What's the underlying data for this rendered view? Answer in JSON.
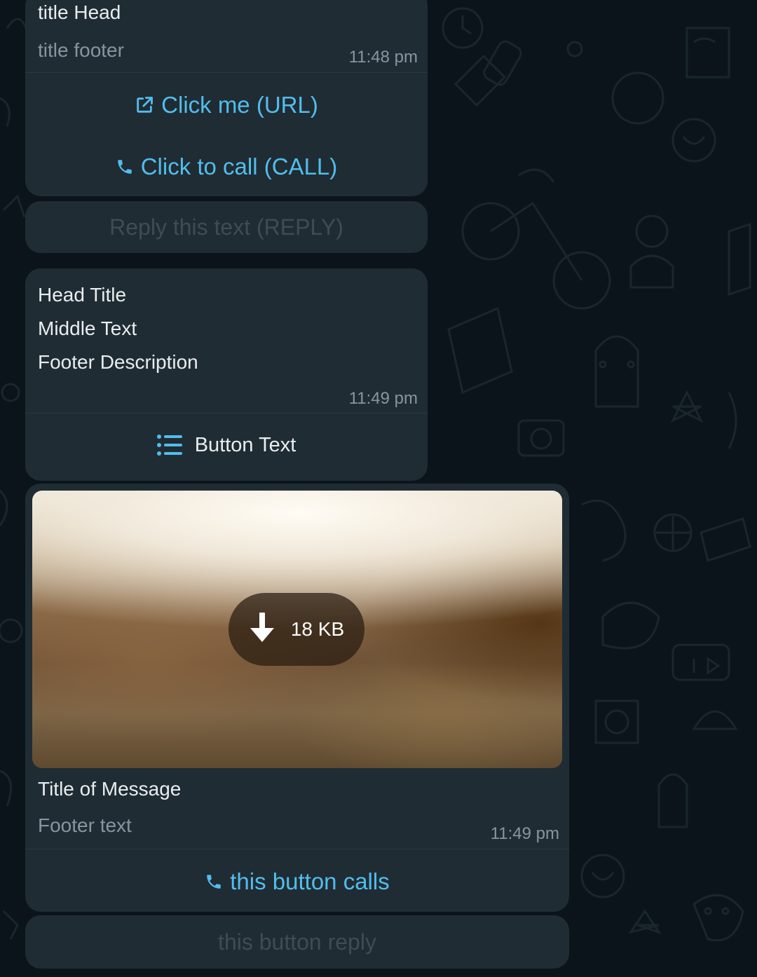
{
  "messages": [
    {
      "header": "title Head",
      "footer": "title footer",
      "time": "11:48 pm",
      "buttons": [
        {
          "label": "Click me (URL)",
          "icon": "external-link-icon"
        },
        {
          "label": "Click to call (CALL)",
          "icon": "phone-icon"
        }
      ],
      "reply_button": "Reply this text (REPLY)"
    },
    {
      "lines": [
        "Head Title",
        "Middle Text",
        "Footer Description"
      ],
      "time": "11:49 pm",
      "list_button": {
        "label": "Button Text",
        "icon": "list-icon"
      }
    },
    {
      "media": {
        "download_size": "18 KB",
        "icon": "download-arrow-icon"
      },
      "title": "Title of Message",
      "footer": "Footer text",
      "time": "11:49 pm",
      "call_button": {
        "label": "this button calls",
        "icon": "phone-icon"
      },
      "reply_button": "this button reply"
    }
  ],
  "colors": {
    "background": "#0b141a",
    "bubble": "#1f2c34",
    "link": "#53bdeb",
    "text": "#e9edef",
    "muted": "#8696a0"
  }
}
